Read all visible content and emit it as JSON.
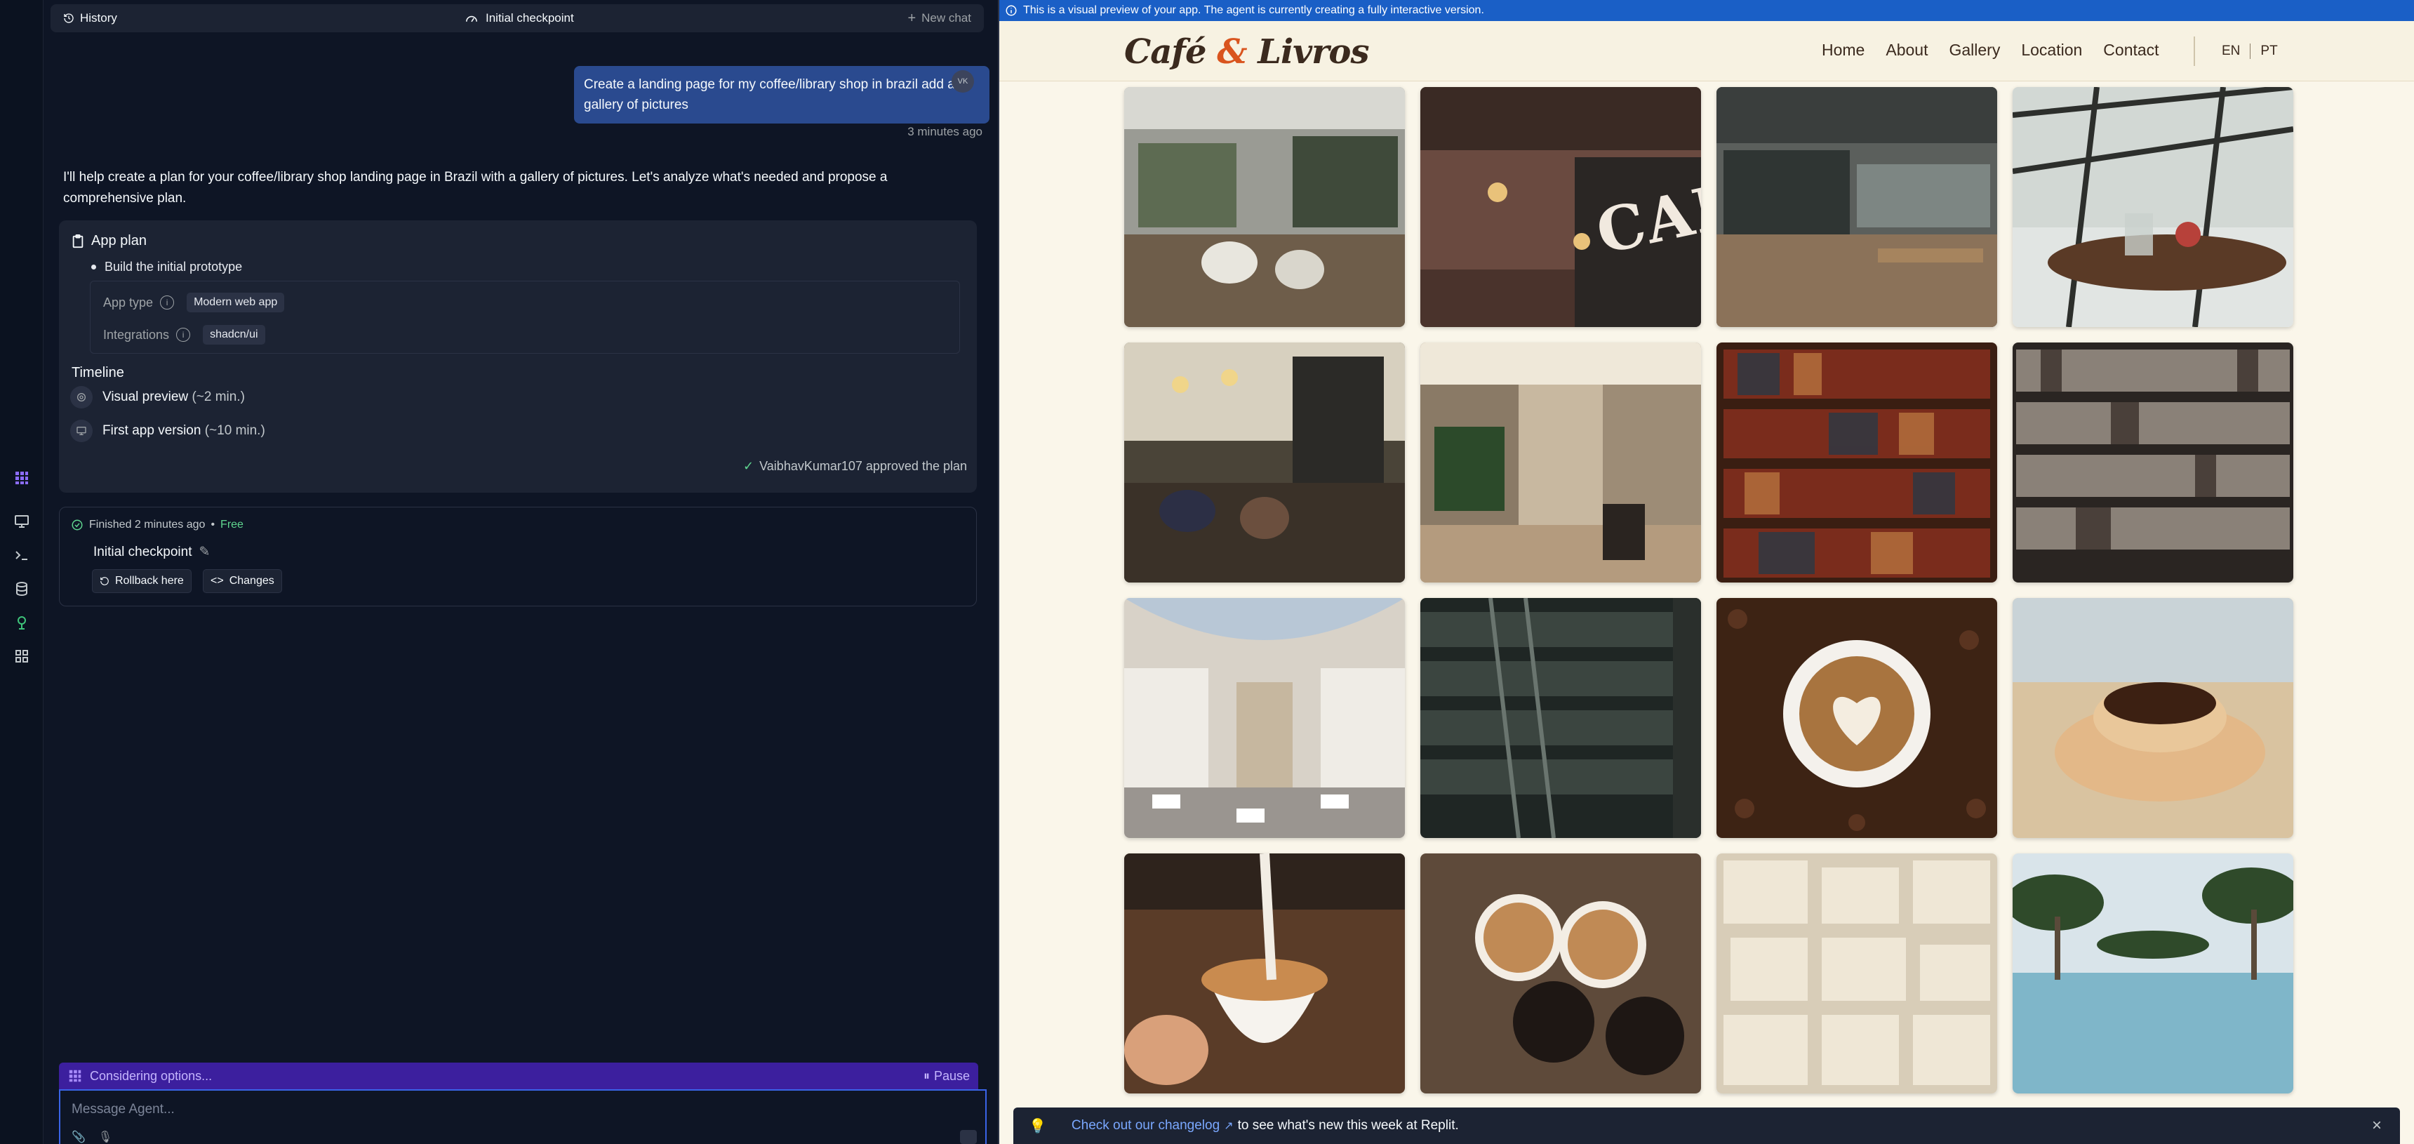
{
  "agent": {
    "topbar": {
      "history_label": "History",
      "checkpoint_label": "Initial checkpoint",
      "new_chat_label": "New chat"
    },
    "user_message": {
      "text": "Create a landing page for my coffee/library shop in brazil add a gallery of pictures",
      "avatar_initials": "VK",
      "timestamp": "3 minutes ago"
    },
    "agent_reply": "I'll help create a plan for your coffee/library shop landing page in Brazil with a gallery of pictures. Let's analyze what's needed and propose a comprehensive plan.",
    "plan": {
      "title": "App plan",
      "bullet": "Build the initial prototype",
      "app_type_label": "App type",
      "app_type_value": "Modern web app",
      "integrations_label": "Integrations",
      "integrations_value": "shadcn/ui",
      "timeline_title": "Timeline",
      "timeline": [
        {
          "label": "Visual preview",
          "eta": "(~2 min.)"
        },
        {
          "label": "First app version",
          "eta": "(~10 min.)"
        }
      ],
      "approved_text": "VaibhavKumar107 approved the plan"
    },
    "checkpoint": {
      "status": "Finished 2 minutes ago",
      "separator": "•",
      "price": "Free",
      "name": "Initial checkpoint",
      "rollback_label": "Rollback here",
      "changes_label": "Changes"
    },
    "status_bar": {
      "text": "Considering options...",
      "pause_label": "Pause"
    },
    "input": {
      "placeholder": "Message Agent..."
    }
  },
  "preview": {
    "banner": "This is a visual preview of your app. The agent is currently creating a fully interactive version.",
    "site": {
      "logo_part1": "Café ",
      "logo_amp": "&",
      "logo_part2": " Livros",
      "nav": [
        "Home",
        "About",
        "Gallery",
        "Location",
        "Contact"
      ],
      "lang": [
        "EN",
        "PT"
      ],
      "cafe_sign": "CAFE"
    },
    "toast": {
      "link_text": "Check out our changelog",
      "rest_text": "to see what's new this week at Replit."
    }
  },
  "colors": {
    "agent_bg": "#0e1525",
    "panel_bg": "#1c2333",
    "accent_blue": "#3a64e8",
    "purple_status": "#3c1f9e",
    "banner_blue": "#1a5fc6",
    "cream_bg": "#faf6ea",
    "logo_brown": "#3b2a1e",
    "logo_orange": "#d9541e",
    "free_green": "#5fd48f"
  }
}
